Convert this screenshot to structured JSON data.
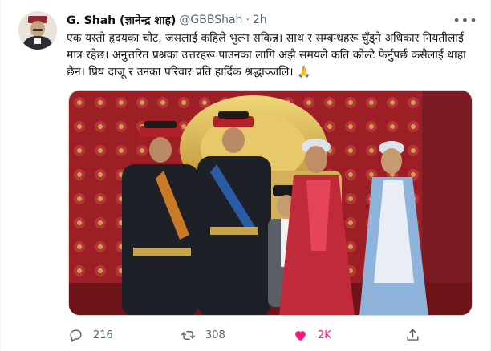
{
  "tweet": {
    "author_name": "G. Shah (ज्ञानेन्द्र शाह)",
    "handle": "@GBBShah",
    "separator": "·",
    "time": "2h",
    "text": "एक यस्तो हृदयका चोट, जसलाई कहिले भुल्न सकिन्न। साथ र सम्बन्धहरू चुँड्ने अधिकार नियतीलाई मात्र रहेछ। अनुत्तरित प्रश्नका उत्तरहरू पाउनका लागि अझै समयले कति कोल्टे फेर्नुपर्छ कसैलाई थाहा छैन। प्रिय दाजू र उनका परिवार प्रति हार्दिक श्रद्धाञ्जलि। 🙏"
  },
  "actions": {
    "reply_count": "216",
    "retweet_count": "308",
    "like_count": "2K"
  },
  "icons": {
    "more": "more-icon",
    "reply": "reply-icon",
    "retweet": "retweet-icon",
    "like": "heart-icon",
    "share": "share-icon"
  },
  "colors": {
    "like_active": "#f91880",
    "muted": "#536471",
    "text": "#0f1419"
  }
}
